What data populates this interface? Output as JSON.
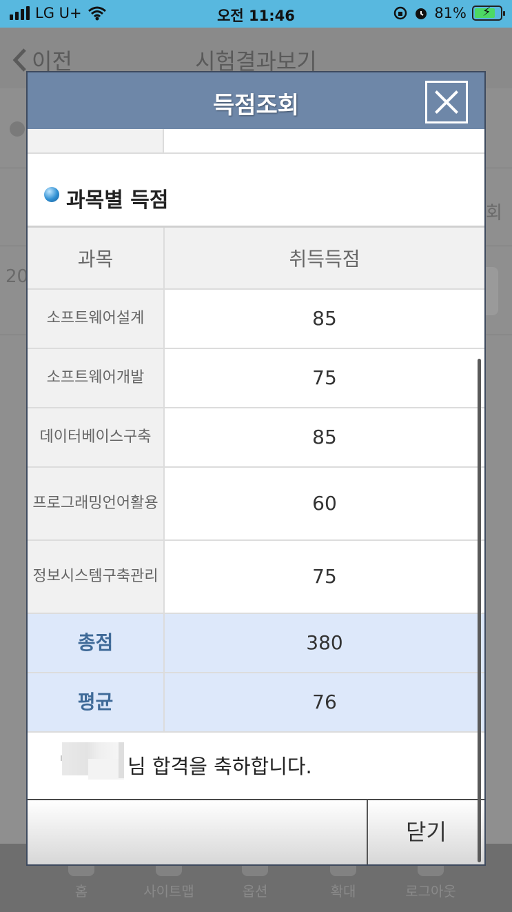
{
  "status_bar": {
    "carrier": "LG U+",
    "time": "오전 11:46",
    "battery_percent": "81%",
    "battery_level": 0.81
  },
  "background": {
    "back_label": "이전",
    "title": "시험결과보기",
    "fragment_left": "20",
    "fragment_right": "회",
    "nav": [
      "홈",
      "사이트맵",
      "옵션",
      "확대",
      "로그아웃"
    ]
  },
  "modal": {
    "title": "득점조회",
    "section_title": "과목별 득점",
    "table": {
      "headers": [
        "과목",
        "취득득점"
      ],
      "rows": [
        {
          "subject": "소프트웨어설계",
          "score": "85"
        },
        {
          "subject": "소프트웨어개발",
          "score": "75"
        },
        {
          "subject": "데이터베이스구축",
          "score": "85"
        },
        {
          "subject": "프로그래밍언어활용",
          "score": "60"
        },
        {
          "subject": "정보시스템구축관리",
          "score": "75"
        }
      ],
      "total_label": "총점",
      "total_value": "380",
      "average_label": "평균",
      "average_value": "76"
    },
    "congrats_text": "님 합격을 축하합니다.",
    "close_label": "닫기"
  },
  "colors": {
    "status_bar": "#58b8df",
    "modal_header": "#6e87a8",
    "summary_row": "#dde8fa",
    "summary_label": "#3f6a98"
  }
}
